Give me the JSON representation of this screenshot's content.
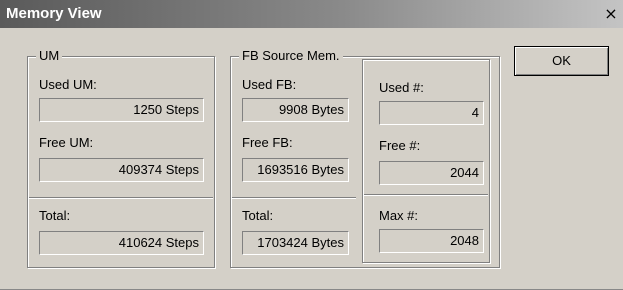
{
  "window": {
    "title": "Memory View",
    "close_glyph": "×"
  },
  "um": {
    "legend": "UM",
    "used_label": "Used UM:",
    "used_value": "1250 Steps",
    "free_label": "Free UM:",
    "free_value": "409374 Steps",
    "total_label": "Total:",
    "total_value": "410624 Steps"
  },
  "fb": {
    "legend": "FB Source Mem.",
    "used_label": "Used FB:",
    "used_value": "9908 Bytes",
    "free_label": "Free FB:",
    "free_value": "1693516 Bytes",
    "total_label": "Total:",
    "total_value": "1703424 Bytes",
    "used_count_label": "Used #:",
    "used_count_value": "4",
    "free_count_label": "Free #:",
    "free_count_value": "2044",
    "max_count_label": "Max #:",
    "max_count_value": "2048"
  },
  "buttons": {
    "ok_label": "OK"
  }
}
